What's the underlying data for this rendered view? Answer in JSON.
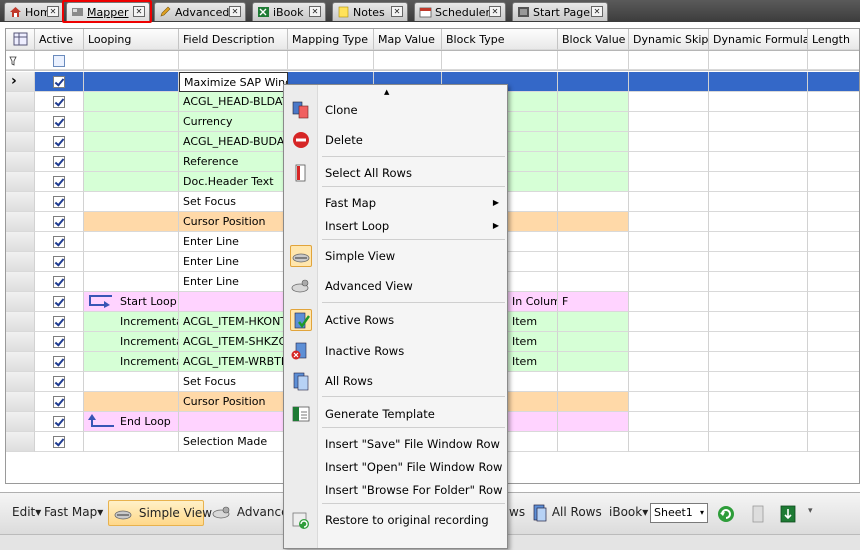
{
  "tabs": [
    {
      "label": "Home",
      "icon": "home-icon"
    },
    {
      "label": "Mapper",
      "icon": "mapper-icon",
      "active": true
    },
    {
      "label": "Advanced",
      "icon": "pencil-icon"
    },
    {
      "label": "iBook",
      "icon": "excel-icon"
    },
    {
      "label": "Notes",
      "icon": "note-icon"
    },
    {
      "label": "Scheduler",
      "icon": "scheduler-icon"
    },
    {
      "label": "Start Page",
      "icon": "start-page-icon"
    }
  ],
  "tab_close": "✕",
  "grid": {
    "columns": [
      "Active",
      "Looping",
      "Field Description",
      "Mapping Type",
      "Map Value",
      "Block Type",
      "Block Value",
      "Dynamic Skip",
      "Dynamic Formula",
      "Length"
    ],
    "rows": [
      {
        "color": "blue",
        "looping": "",
        "field": "Maximize SAP Window",
        "block_type": "",
        "block_value": ""
      },
      {
        "color": "green",
        "looping": "",
        "field": "ACGL_HEAD-BLDAT",
        "block_type": "",
        "block_value": ""
      },
      {
        "color": "green",
        "looping": "",
        "field": "Currency",
        "block_type": "",
        "block_value": ""
      },
      {
        "color": "green",
        "looping": "",
        "field": "ACGL_HEAD-BUDAT",
        "block_type": "",
        "block_value": ""
      },
      {
        "color": "green",
        "looping": "",
        "field": "Reference",
        "block_type": "",
        "block_value": ""
      },
      {
        "color": "green",
        "looping": "",
        "field": "Doc.Header Text",
        "block_type": "",
        "block_value": ""
      },
      {
        "color": "white",
        "looping": "",
        "field": "Set Focus",
        "block_type": "",
        "block_value": ""
      },
      {
        "color": "orange",
        "looping": "",
        "field": "Cursor Position",
        "block_type": "",
        "block_value": ""
      },
      {
        "color": "white",
        "looping": "",
        "field": "Enter Line",
        "block_type": "",
        "block_value": ""
      },
      {
        "color": "white",
        "looping": "",
        "field": "Enter Line",
        "block_type": "",
        "block_value": ""
      },
      {
        "color": "white",
        "looping": "",
        "field": "Enter Line",
        "block_type": "",
        "block_value": ""
      },
      {
        "color": "pink",
        "looping": "Start Loop",
        "field": "",
        "block_type": "In Column",
        "block_value": "F",
        "loop": "start"
      },
      {
        "color": "green",
        "looping": "Incremental",
        "field": "ACGL_ITEM-HKONT",
        "block_type": "Item",
        "block_value": ""
      },
      {
        "color": "green",
        "looping": "Incremental",
        "field": "ACGL_ITEM-SHKZG",
        "block_type": "Item",
        "block_value": ""
      },
      {
        "color": "green",
        "looping": "Incremental",
        "field": "ACGL_ITEM-WRBTR",
        "block_type": "Item",
        "block_value": ""
      },
      {
        "color": "white",
        "looping": "",
        "field": "Set Focus",
        "block_type": "",
        "block_value": ""
      },
      {
        "color": "orange",
        "looping": "",
        "field": "Cursor Position",
        "block_type": "",
        "block_value": ""
      },
      {
        "color": "pink",
        "looping": "End Loop",
        "field": "",
        "block_type": "",
        "block_value": "",
        "loop": "end"
      },
      {
        "color": "white",
        "looping": "",
        "field": "Selection Made",
        "block_type": "",
        "block_value": ""
      }
    ],
    "colors": {
      "green": "#d6ffd6",
      "orange": "#ffd9a8",
      "pink": "#ffd3ff",
      "blue": "#3468c8",
      "white": "#ffffff"
    },
    "current_row_marker": "›"
  },
  "context_menu": {
    "items": [
      {
        "label": "Clone",
        "icon": "clone-icon"
      },
      {
        "label": "Delete",
        "icon": "delete-icon"
      },
      {
        "label": "Select All Rows",
        "icon": "select-all-rows-icon"
      },
      {
        "label": "Fast Map",
        "submenu": true
      },
      {
        "label": "Insert Loop",
        "submenu": true
      },
      {
        "label": "Simple View",
        "icon": "simple-view-icon",
        "checked": true
      },
      {
        "label": "Advanced View",
        "icon": "advanced-view-icon"
      },
      {
        "label": "Active Rows",
        "icon": "active-rows-icon",
        "checked": true
      },
      {
        "label": "Inactive Rows",
        "icon": "inactive-rows-icon"
      },
      {
        "label": "All Rows",
        "icon": "all-rows-icon"
      },
      {
        "label": "Generate Template",
        "icon": "generate-template-icon"
      },
      {
        "label": "Insert \"Save\" File Window Row"
      },
      {
        "label": "Insert \"Open\" File Window Row"
      },
      {
        "label": "Insert \"Browse For Folder\" Row"
      },
      {
        "label": "Restore to original recording",
        "icon": "restore-icon"
      }
    ],
    "submenu_arrow": "▶",
    "scroll_up": "▲"
  },
  "toolbar": {
    "edit": "Edit",
    "fast_map": "Fast Map",
    "simple_view": "Simple View",
    "advanced": "Advanced",
    "rows_partial": "ws",
    "all_rows": "All Rows",
    "ibook": "iBook",
    "sheet": "Sheet1",
    "dropdown_arrow": "▾"
  }
}
